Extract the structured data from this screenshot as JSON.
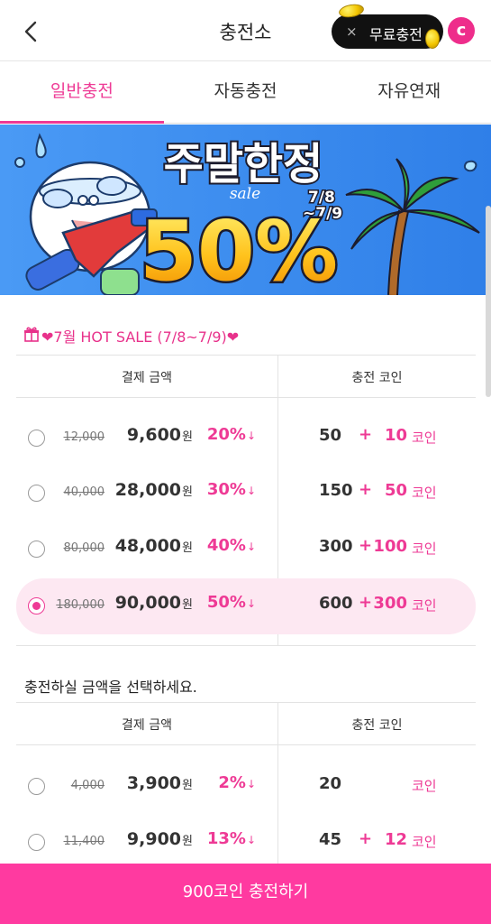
{
  "header": {
    "title": "충전소",
    "free_charge_label": "무료충전",
    "close_symbol": "×",
    "logo_letter": "c"
  },
  "tabs": [
    {
      "label": "일반충전",
      "active": true
    },
    {
      "label": "자동충전",
      "active": false
    },
    {
      "label": "자유연재",
      "active": false
    }
  ],
  "banner": {
    "headline": "주말한정",
    "sale_word": "sale",
    "date_top": "7/8",
    "date_bottom": "~7/9",
    "discount": "50%"
  },
  "sale_section": {
    "title": "❤7월 HOT SALE (7/8~7/9)❤",
    "col_price": "결제 금액",
    "col_coin": "충전 코인",
    "rows": [
      {
        "original": "12,000",
        "price": "9,600",
        "won": "원",
        "discount": "20%",
        "arrow": "↓",
        "base": "50",
        "plus": "+",
        "bonus": "10",
        "unit": "코인",
        "selected": false
      },
      {
        "original": "40,000",
        "price": "28,000",
        "won": "원",
        "discount": "30%",
        "arrow": "↓",
        "base": "150",
        "plus": "+",
        "bonus": "50",
        "unit": "코인",
        "selected": false
      },
      {
        "original": "80,000",
        "price": "48,000",
        "won": "원",
        "discount": "40%",
        "arrow": "↓",
        "base": "300",
        "plus": "+",
        "bonus": "100",
        "unit": "코인",
        "selected": false
      },
      {
        "original": "180,000",
        "price": "90,000",
        "won": "원",
        "discount": "50%",
        "arrow": "↓",
        "base": "600",
        "plus": "+",
        "bonus": "300",
        "unit": "코인",
        "selected": true
      }
    ]
  },
  "normal_section": {
    "title": "충전하실 금액을 선택하세요.",
    "col_price": "결제 금액",
    "col_coin": "충전 코인",
    "rows": [
      {
        "original": "4,000",
        "price": "3,900",
        "won": "원",
        "discount": "2%",
        "arrow": "↓",
        "base": "20",
        "plus": "",
        "bonus": "",
        "unit": "코인",
        "selected": false
      },
      {
        "original": "11,400",
        "price": "9,900",
        "won": "원",
        "discount": "13%",
        "arrow": "↓",
        "base": "45",
        "plus": "+",
        "bonus": "12",
        "unit": "코인",
        "selected": false
      }
    ]
  },
  "charge_button": {
    "label": "900코인 충전하기"
  },
  "colors": {
    "accent": "#ee3a95",
    "button": "#ff3aa0",
    "banner_bg": "#3b8df0",
    "selected_row": "#fde8f2"
  }
}
